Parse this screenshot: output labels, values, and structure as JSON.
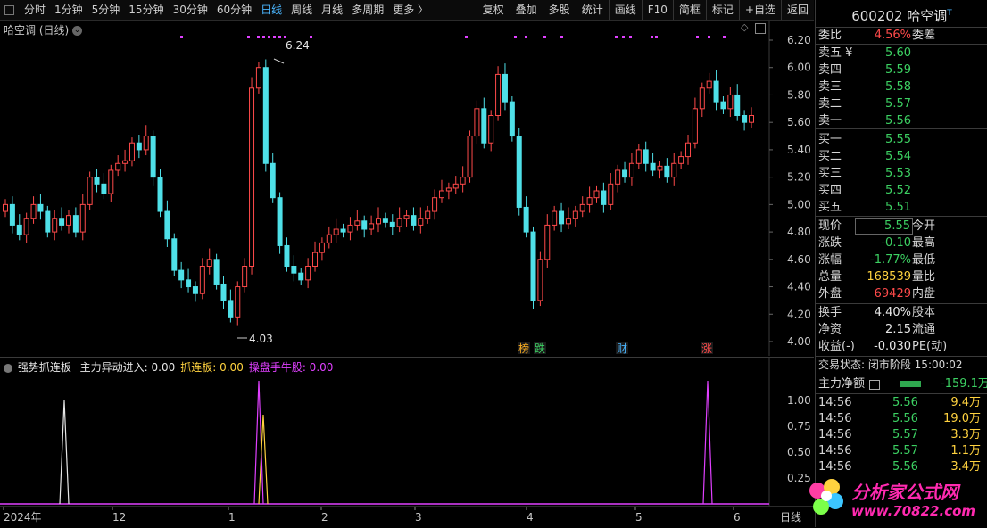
{
  "toolbar": {
    "periods": [
      "分时",
      "1分钟",
      "5分钟",
      "15分钟",
      "30分钟",
      "60分钟",
      "日线",
      "周线",
      "月线",
      "多周期",
      "更多 〉"
    ],
    "active_index": 6,
    "right_buttons": [
      "复权",
      "叠加",
      "多股",
      "统计",
      "画线",
      "F10",
      "简框",
      "标记",
      "+自选",
      "返回"
    ]
  },
  "main": {
    "title": "哈空调 (日线)",
    "price_labels": [
      "6.20",
      "6.00",
      "5.80",
      "5.60",
      "5.40",
      "5.20",
      "5.00",
      "4.80",
      "4.60",
      "4.40",
      "4.20",
      "4.00"
    ],
    "high_label": "6.24",
    "low_label": "4.03",
    "markers": [
      {
        "text": "榜",
        "color": "#ffb020"
      },
      {
        "text": "跌",
        "color": "#3cd062"
      },
      {
        "text": "财",
        "color": "#4ab6ff"
      },
      {
        "text": "涨",
        "color": "#ff4a4a"
      }
    ]
  },
  "indicator": {
    "name": "强势抓连板",
    "items": [
      {
        "text": "主力异动进入: 0.00",
        "color": "#e6e6e6"
      },
      {
        "text": "抓连板: 0.00",
        "color": "#ffd23f"
      },
      {
        "text": "操盘手牛股: 0.00",
        "color": "#e040ff"
      }
    ],
    "y_labels": [
      "1.00",
      "0.75",
      "0.50",
      "0.25"
    ]
  },
  "xaxis": {
    "labels": [
      "2024年",
      "12",
      "1",
      "2",
      "3",
      "4",
      "5",
      "6"
    ],
    "period": "日线"
  },
  "panel": {
    "code": "600202",
    "name": "哈空调",
    "weibi_label": "委比",
    "weibi_value": "4.56%",
    "weicha_label": "委差",
    "asks": [
      {
        "label": "卖五 ¥",
        "price": "5.60"
      },
      {
        "label": "卖四",
        "price": "5.59"
      },
      {
        "label": "卖三",
        "price": "5.58"
      },
      {
        "label": "卖二",
        "price": "5.57"
      },
      {
        "label": "卖一",
        "price": "5.56"
      }
    ],
    "bids": [
      {
        "label": "买一",
        "price": "5.55"
      },
      {
        "label": "买二",
        "price": "5.54"
      },
      {
        "label": "买三",
        "price": "5.53"
      },
      {
        "label": "买四",
        "price": "5.52"
      },
      {
        "label": "买五",
        "price": "5.51"
      }
    ],
    "quote": [
      {
        "label": "现价",
        "value": "5.55",
        "color": "green",
        "label2": "今开"
      },
      {
        "label": "涨跌",
        "value": "-0.10",
        "color": "green",
        "label2": "最高"
      },
      {
        "label": "涨幅",
        "value": "-1.77%",
        "color": "green",
        "label2": "最低"
      },
      {
        "label": "总量",
        "value": "168539",
        "color": "yellow",
        "label2": "量比"
      },
      {
        "label": "外盘",
        "value": "69429",
        "color": "red",
        "label2": "内盘"
      }
    ],
    "stats": [
      {
        "label": "换手",
        "value": "4.40%",
        "label2": "股本"
      },
      {
        "label": "净资",
        "value": "2.15",
        "label2": "流通"
      },
      {
        "label": "收益(-)",
        "value": "-0.030",
        "label2": "PE(动)"
      }
    ],
    "trade_status": "交易状态: 闭市阶段 15:00:02",
    "net_label": "主力净额",
    "net_value": "-159.1万",
    "ticks": [
      {
        "time": "14:56",
        "price": "5.56",
        "vol": "9.4万"
      },
      {
        "time": "14:56",
        "price": "5.56",
        "vol": "19.0万"
      },
      {
        "time": "14:56",
        "price": "5.57",
        "vol": "3.3万"
      },
      {
        "time": "14:56",
        "price": "5.57",
        "vol": "1.1万"
      },
      {
        "time": "14:56",
        "price": "5.56",
        "vol": "3.4万"
      }
    ]
  },
  "watermark": {
    "title": "分析家公式网",
    "url": "www.70822.com"
  },
  "colors": {
    "up": "#ff4a4a",
    "down": "#4fe0e8",
    "magenta": "#e040ff",
    "yellow": "#ffd23f",
    "accent": "#4ab6ff"
  }
}
